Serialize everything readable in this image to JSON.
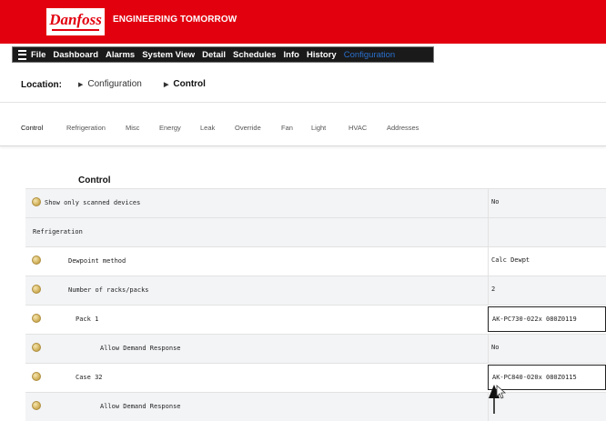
{
  "header": {
    "logo_text": "Danfoss",
    "tagline": "ENGINEERING TOMORROW",
    "brand_color": "#e2000f"
  },
  "menu": {
    "items": [
      "File",
      "Dashboard",
      "Alarms",
      "System View",
      "Detail",
      "Schedules",
      "Info",
      "History",
      "Configuration"
    ],
    "active": "Configuration",
    "active_color": "#2a6fcc"
  },
  "location": {
    "label": "Location:",
    "crumbs": [
      "Configuration",
      "Control"
    ]
  },
  "tabs": {
    "items": [
      "Control",
      "Refrigeration",
      "Misc",
      "Energy",
      "Leak",
      "Override",
      "Fan",
      "Light",
      "HVAC",
      "Addresses"
    ],
    "active": "Control"
  },
  "section": {
    "title": "Control"
  },
  "rows": [
    {
      "label": "Show only scanned devices",
      "value": "No"
    },
    {
      "label": "Refrigeration",
      "value": ""
    },
    {
      "label": "Dewpoint method",
      "value": "Calc Dewpt"
    },
    {
      "label": "Number of racks/packs",
      "value": "2"
    },
    {
      "label": "Pack 1",
      "value": "AK-PC730-022x 080Z0119"
    },
    {
      "label": "Allow Demand Response",
      "value": "No"
    },
    {
      "label": "Case 32",
      "value": "AK-PC840-020x 080Z0115"
    },
    {
      "label": "Allow Demand Response",
      "value": ""
    }
  ]
}
